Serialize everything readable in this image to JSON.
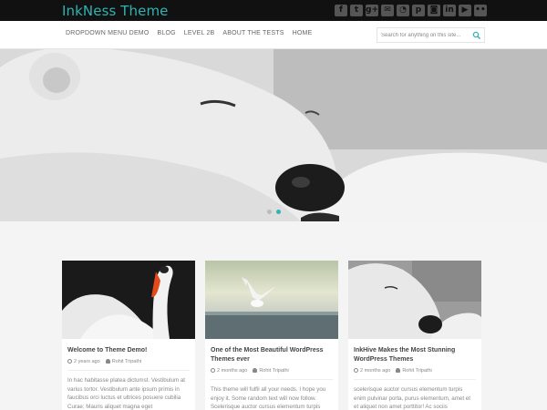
{
  "site": {
    "title": "InkNess Theme"
  },
  "social_icons": [
    {
      "name": "facebook-icon",
      "glyph": "f"
    },
    {
      "name": "twitter-icon",
      "glyph": "t"
    },
    {
      "name": "google-plus-icon",
      "glyph": "g+"
    },
    {
      "name": "email-icon",
      "glyph": "✉"
    },
    {
      "name": "rss-icon",
      "glyph": "◔"
    },
    {
      "name": "pinterest-icon",
      "glyph": "p"
    },
    {
      "name": "instagram-icon",
      "glyph": "◙"
    },
    {
      "name": "linkedin-icon",
      "glyph": "in"
    },
    {
      "name": "youtube-icon",
      "glyph": "▶"
    },
    {
      "name": "flickr-icon",
      "glyph": "••"
    }
  ],
  "nav": {
    "items": [
      "DROPDOWN MENU DEMO",
      "BLOG",
      "LEVEL 2B",
      "ABOUT THE TESTS",
      "HOME"
    ]
  },
  "search": {
    "placeholder": "Search for anything on this site..."
  },
  "slider": {
    "slides": 2,
    "active": 2
  },
  "colors": {
    "accent": "#2fb3b3",
    "topbar": "#111111"
  },
  "posts": [
    {
      "title": "Welcome to Theme Demo!",
      "date": "2 years ago",
      "author": "Rohit Tripathi",
      "excerpt": "In hac habitasse platea dictumst. Vestibulum at varius tortor. Vestibulum ante ipsum primis in faucibus orci luctus et ultrices posuere cubilia Curae; Mauris aliquet magna eget"
    },
    {
      "title": "One of the Most Beautiful WordPress Themes ever",
      "date": "2 months ago",
      "author": "Rohit Tripathi",
      "excerpt": "This theme will fulfil all your needs. I hope you enjoy it. Some random text will now follow. Scelerisque auctor cursus elementum turpis"
    },
    {
      "title": "InkHive Makes the Most Stunning WordPress Themes",
      "date": "2 months ago",
      "author": "Rohit Tripathi",
      "excerpt": "scelerisque auctor cursus elementum turpis enim pulvinar porta, purus elementum, amet et et aliquet non amet porttitor! Ac sociis"
    }
  ]
}
